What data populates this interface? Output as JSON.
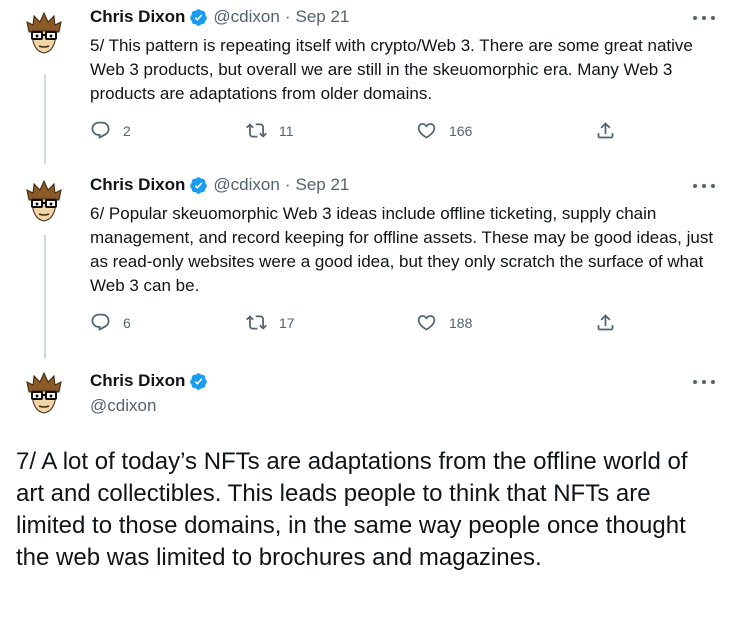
{
  "tweets": [
    {
      "name": "Chris Dixon",
      "handle": "@cdixon",
      "separator": "·",
      "date": "Sep 21",
      "text": "5/ This pattern is repeating itself with crypto/Web 3. There are some great native Web 3 products, but overall we are still in the skeuomorphic era. Many Web 3 products are adaptations from older domains.",
      "replies": "2",
      "retweets": "11",
      "likes": "166"
    },
    {
      "name": "Chris Dixon",
      "handle": "@cdixon",
      "separator": "·",
      "date": "Sep 21",
      "text": "6/ Popular skeuomorphic Web 3 ideas include offline ticketing, supply chain management, and record keeping for offline assets. These may be good ideas, just as read-only websites were a good idea, but they only scratch the surface of what Web 3 can be.",
      "replies": "6",
      "retweets": "17",
      "likes": "188"
    }
  ],
  "main_tweet": {
    "name": "Chris Dixon",
    "handle": "@cdixon",
    "text": "7/ A lot of today’s NFTs are adaptations from the offline world of art and collectibles. This leads people to think that NFTs are limited to those domains, in the same way people once thought the web was limited to brochures and magazines."
  },
  "icons": {
    "verified": "verified-badge-icon",
    "reply": "reply-icon",
    "retweet": "retweet-icon",
    "like": "heart-icon",
    "share": "share-icon",
    "more": "more-icon"
  },
  "colors": {
    "verified": "#1d9bf0",
    "secondary_text": "#536471",
    "thread_line": "#cfd9de"
  }
}
